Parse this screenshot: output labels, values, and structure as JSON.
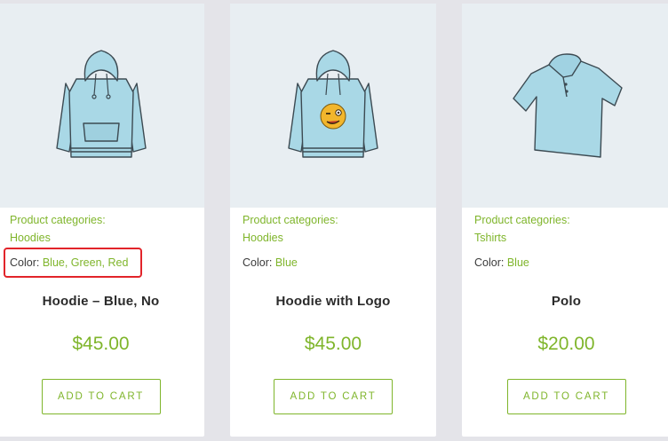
{
  "products": [
    {
      "categories_label": "Product categories:",
      "category": "Hoodies",
      "color_label": "Color:",
      "colors_text": "Blue, Green, Red",
      "title": "Hoodie – Blue, No",
      "price": "$45.00",
      "button_label": "ADD TO CART",
      "image_icon": "blue-hoodie-icon"
    },
    {
      "categories_label": "Product categories:",
      "category": "Hoodies",
      "color_label": "Color:",
      "colors_text": "Blue",
      "title": "Hoodie with Logo",
      "price": "$45.00",
      "button_label": "ADD TO CART",
      "image_icon": "hoodie-with-wink-logo-icon"
    },
    {
      "categories_label": "Product categories:",
      "category": "Tshirts",
      "color_label": "Color:",
      "colors_text": "Blue",
      "title": "Polo",
      "price": "$20.00",
      "button_label": "ADD TO CART",
      "image_icon": "polo-shirt-icon"
    }
  ],
  "colors": {
    "accent_green": "#7fb52b",
    "highlight_red": "#e2242a",
    "background": "#e4e4e9",
    "image_bg": "#e8eef2",
    "garment_blue": "#a9d8e6"
  }
}
